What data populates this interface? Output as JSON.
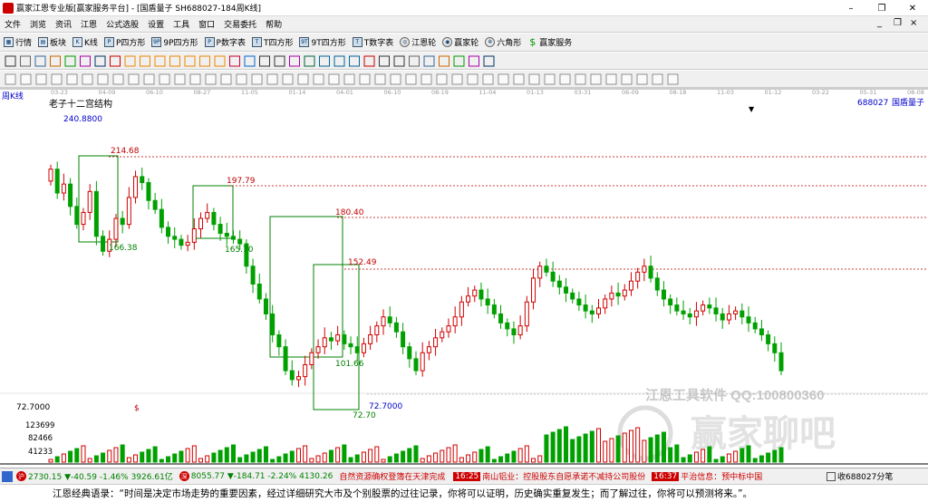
{
  "window": {
    "title": "赢家江恩专业版[赢家服务平台] - [国盾量子  SH688027-184周K线]",
    "controls": [
      "–",
      "❐",
      "✕"
    ]
  },
  "menu": {
    "items": [
      "文件",
      "浏览",
      "资讯",
      "江恩",
      "公式选股",
      "设置",
      "工具",
      "窗口",
      "交易委托",
      "帮助"
    ],
    "sys_buttons": [
      "_",
      "❐",
      "×"
    ]
  },
  "toolbar1": {
    "items": [
      {
        "label": "行情",
        "icon": "grid-icon"
      },
      {
        "label": "板块",
        "icon": "blocks-icon"
      },
      {
        "label": "K线",
        "icon": "kline-icon"
      },
      {
        "label": "P四方形",
        "icon": "p4-icon"
      },
      {
        "label": "9P四方形",
        "icon": "9p-icon"
      },
      {
        "label": "P数字表",
        "icon": "pnum-icon"
      },
      {
        "label": "T四方形",
        "icon": "t4-icon"
      },
      {
        "label": "9T四方形",
        "icon": "9t-icon"
      },
      {
        "label": "T数字表",
        "icon": "tnum-icon"
      },
      {
        "label": "江恩轮",
        "icon": "wheel-icon"
      },
      {
        "label": "赢家轮",
        "icon": "wheel2-icon"
      },
      {
        "label": "六角形",
        "icon": "hexagon-icon"
      },
      {
        "label": "赢家服务",
        "icon": "dollar-icon"
      }
    ],
    "icon_glyphs": [
      "▦",
      "▤",
      "K",
      "P",
      "9P",
      "P",
      "T",
      "9T",
      "T",
      "◎",
      "◉",
      "✲",
      "$"
    ]
  },
  "chart": {
    "period_label": "周K线",
    "study_title": "老子十二宫结构",
    "code": "688027",
    "name": "国盾量子",
    "dropdown": "▼",
    "date_labels": [
      "03-23",
      "04-09",
      "06-10",
      "08-27",
      "11-05",
      "01-14",
      "04-01",
      "06-10",
      "08-19",
      "11-04",
      "01-13",
      "03-31",
      "06-09",
      "08-18",
      "11-03",
      "01-12",
      "03-22",
      "05-31",
      "08-08"
    ],
    "price_labels": [
      {
        "text": "240.8800",
        "color": "#0000cc"
      },
      {
        "text": "214.68",
        "color": "#c00000"
      },
      {
        "text": "197.79",
        "color": "#c00000"
      },
      {
        "text": "180.40",
        "color": "#c00000"
      },
      {
        "text": "152.49",
        "color": "#c00000"
      },
      {
        "text": "166.38",
        "color": "#008000"
      },
      {
        "text": "165.70",
        "color": "#008000"
      },
      {
        "text": "101.66",
        "color": "#008000"
      },
      {
        "text": "72.70",
        "color": "#008000"
      },
      {
        "text": "72.7000",
        "color": "#0000cc"
      }
    ],
    "left_axis_price": "72.7000",
    "dollar_mark": "$",
    "watermark_top": "江恩工具软件  QQ:100800360",
    "watermark_bottom": "赢家聊吧",
    "volume_labels": [
      "123699",
      "82466",
      "41233"
    ],
    "colors": {
      "up": "#d00000",
      "down": "#00a000",
      "box": "#008000",
      "line": "#c00000",
      "annotation": "#0000cc"
    }
  },
  "status": {
    "sh_badge": "沪",
    "sh_text": "2730.15 ▼-40.59 -1.46% 3926.61亿",
    "sz_badge": "深",
    "sz_text": "8055.77 ▼-184.71 -2.24% 4130.26",
    "news1": "自然资源确权登簿在天津完成",
    "time1": "16:25",
    "news2": "南山铝业：控股股东自愿承诺不减持公司股份",
    "time2": "16:37",
    "news3": "平治信息：预中标中国",
    "right_text": "收688027分笔",
    "right_icon": "calculator-icon"
  },
  "quote": "江恩经典语录：“时间是决定市场走势的重要因素，经过详细研究大市及个别股票的过往记录，你将可以证明，历史确实重复发生；而了解过往，你将可以预测将来。”。"
}
